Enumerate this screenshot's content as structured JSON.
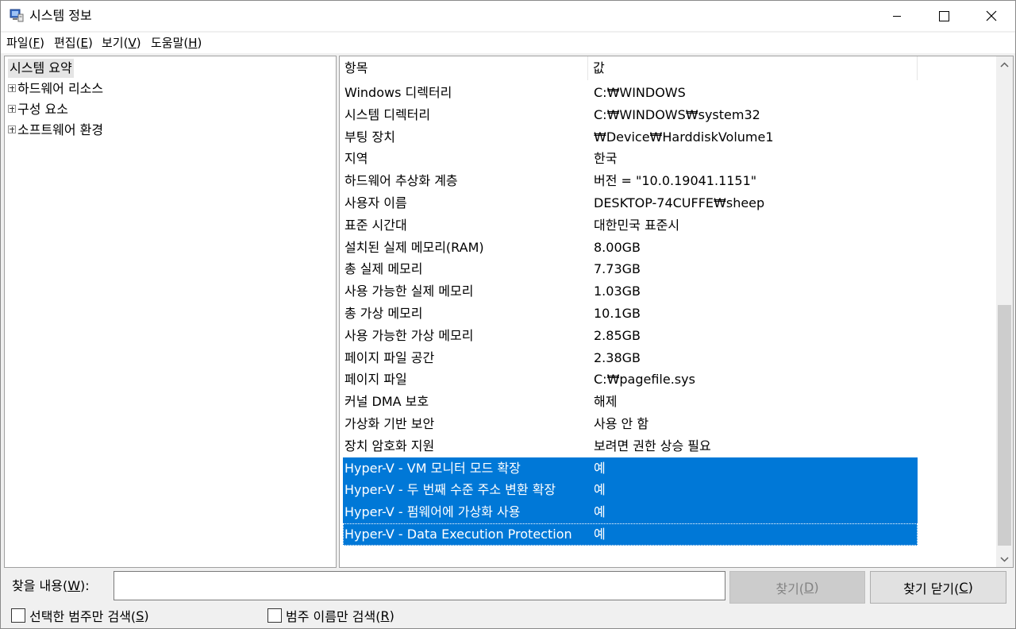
{
  "window": {
    "title": "시스템 정보",
    "controls": {
      "minimize": "minimize",
      "maximize": "maximize",
      "close": "close"
    }
  },
  "menu": [
    {
      "label": "파일(",
      "accel": "F",
      "suffix": ")"
    },
    {
      "label": "편집(",
      "accel": "E",
      "suffix": ")"
    },
    {
      "label": "보기(",
      "accel": "V",
      "suffix": ")"
    },
    {
      "label": "도움말(",
      "accel": "H",
      "suffix": ")"
    }
  ],
  "tree": {
    "root": "시스템 요약",
    "children": [
      "하드웨어 리소스",
      "구성 요소",
      "소프트웨어 환경"
    ]
  },
  "list": {
    "columns": [
      "항목",
      "값"
    ],
    "rows": [
      {
        "key": "Windows 디렉터리",
        "value": "C:₩WINDOWS"
      },
      {
        "key": "시스템 디렉터리",
        "value": "C:₩WINDOWS₩system32"
      },
      {
        "key": "부팅 장치",
        "value": "₩Device₩HarddiskVolume1"
      },
      {
        "key": "지역",
        "value": "한국"
      },
      {
        "key": "하드웨어 추상화 계층",
        "value": "버전 = \"10.0.19041.1151\""
      },
      {
        "key": "사용자 이름",
        "value": "DESKTOP-74CUFFE₩sheep"
      },
      {
        "key": "표준 시간대",
        "value": "대한민국 표준시"
      },
      {
        "key": "설치된 실제 메모리(RAM)",
        "value": "8.00GB"
      },
      {
        "key": "총 실제 메모리",
        "value": "7.73GB"
      },
      {
        "key": "사용 가능한 실제 메모리",
        "value": "1.03GB"
      },
      {
        "key": "총 가상 메모리",
        "value": "10.1GB"
      },
      {
        "key": "사용 가능한 가상 메모리",
        "value": "2.85GB"
      },
      {
        "key": "페이지 파일 공간",
        "value": "2.38GB"
      },
      {
        "key": "페이지 파일",
        "value": "C:₩pagefile.sys"
      },
      {
        "key": "커널 DMA 보호",
        "value": "해제"
      },
      {
        "key": "가상화 기반 보안",
        "value": "사용 안 함"
      },
      {
        "key": "장치 암호화 지원",
        "value": "보려면 권한 상승 필요"
      },
      {
        "key": "Hyper-V - VM 모니터 모드 확장",
        "value": "예"
      },
      {
        "key": "Hyper-V - 두 번째 수준 주소 변환 확장",
        "value": "예"
      },
      {
        "key": "Hyper-V - 펌웨어에 가상화 사용",
        "value": "예"
      },
      {
        "key": "Hyper-V - Data Execution Protection",
        "value": "예"
      }
    ]
  },
  "find": {
    "label_pre": "찾을 내용(",
    "label_accel": "W",
    "label_post": "):",
    "value": "",
    "find_button_pre": "찾기(",
    "find_button_accel": "D",
    "find_button_post": ")",
    "close_button_pre": "찾기 닫기(",
    "close_button_accel": "C",
    "close_button_post": ")",
    "check_selected_pre": "선택한 범주만 검색(",
    "check_selected_accel": "S",
    "check_selected_post": ")",
    "check_names_pre": "범주 이름만 검색(",
    "check_names_accel": "R",
    "check_names_post": ")"
  },
  "colors": {
    "selection": "#0078d7",
    "disabled_text": "#838383"
  }
}
